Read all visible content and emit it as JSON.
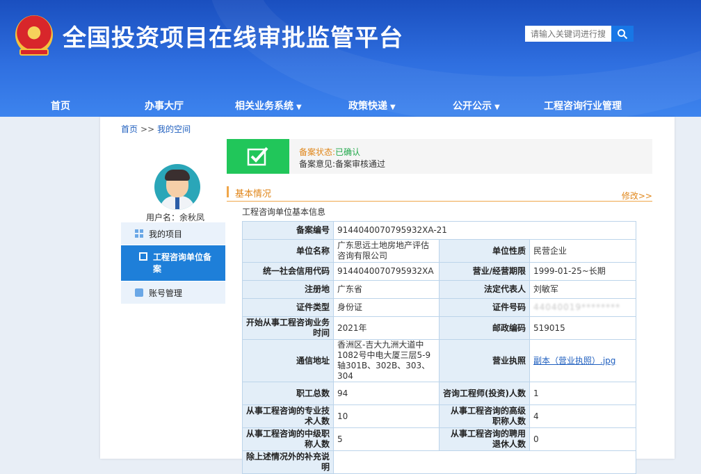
{
  "header": {
    "site_title": "全国投资项目在线审批监管平台",
    "search_placeholder": "请输入关键词进行搜索"
  },
  "nav": {
    "items": [
      {
        "label": "首页",
        "dropdown": false
      },
      {
        "label": "办事大厅",
        "dropdown": false
      },
      {
        "label": "相关业务系统",
        "dropdown": true
      },
      {
        "label": "政策快递",
        "dropdown": true
      },
      {
        "label": "公开公示",
        "dropdown": true
      },
      {
        "label": "工程咨询行业管理",
        "dropdown": false
      }
    ]
  },
  "breadcrumb": {
    "home": "首页",
    "sep": ">>",
    "current": "我的空间"
  },
  "user": {
    "username_label": "用户名：余秋凤"
  },
  "side_menu": {
    "items": [
      {
        "label": "我的项目",
        "icon": "grid-icon"
      },
      {
        "label": "工程咨询单位备案",
        "icon": "document-icon",
        "active": true
      },
      {
        "label": "账号管理",
        "icon": "user-card-icon"
      }
    ]
  },
  "status": {
    "label": "备案状态:",
    "value": "已确认",
    "opinion": "备案意见:备案审核通过"
  },
  "section": {
    "title": "基本情况",
    "edit": "修改>>",
    "subtitle": "工程咨询单位基本信息"
  },
  "colors": {
    "header": "#2f6fe0",
    "active_menu": "#1e7fd9",
    "status_green": "#21c65a",
    "accent_orange": "#e0861a"
  },
  "table": {
    "r1": {
      "l1": "备案编号",
      "v1": "9144040070795932XA-21"
    },
    "r2": {
      "l1": "单位名称",
      "v1": "广东思远土地房地产评估咨询有限公司",
      "l2": "单位性质",
      "v2": "民营企业"
    },
    "r3": {
      "l1": "统一社会信用代码",
      "v1": "9144040070795932XA",
      "l2": "营业/经营期限",
      "v2": "1999-01-25~长期"
    },
    "r4": {
      "l1": "注册地",
      "v1": "广东省",
      "l2": "法定代表人",
      "v2": "刘敏军"
    },
    "r5": {
      "l1": "证件类型",
      "v1": "身份证",
      "l2": "证件号码",
      "v2": "44040019********"
    },
    "r6": {
      "l1": "开始从事工程咨询业务时间",
      "v1": "2021年",
      "l2": "邮政编码",
      "v2": "519015"
    },
    "r7": {
      "l1": "通信地址",
      "v1": "香洲区-吉大九洲大道中1082号中电大厦三层5-9轴301B、302B、303、304",
      "l2": "营业执照",
      "v2": "副本（营业执照）.jpg"
    },
    "r8": {
      "l1": "职工总数",
      "v1": "94",
      "l2": "咨询工程师(投资)人数",
      "v2": "1"
    },
    "r9": {
      "l1": "从事工程咨询的专业技术人数",
      "v1": "10",
      "l2": "从事工程咨询的高级职称人数",
      "v2": "4"
    },
    "r10": {
      "l1": "从事工程咨询的中级职称人数",
      "v1": "5",
      "l2": "从事工程咨询的聘用退休人数",
      "v2": "0"
    },
    "r11": {
      "l1": "除上述情况外的补充说明",
      "v1": ""
    }
  }
}
